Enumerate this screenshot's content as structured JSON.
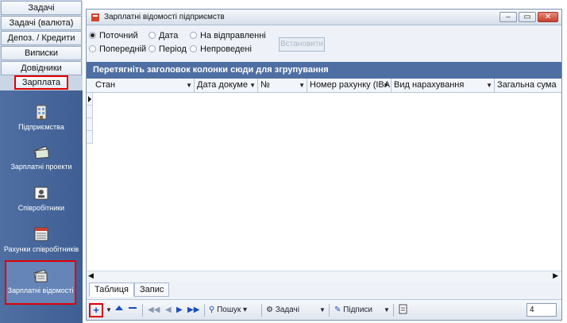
{
  "nav": {
    "top_buttons": [
      "Задачі",
      "Задачі (валюта)",
      "Депоз. / Кредити",
      "Виписки",
      "Довідники",
      "Зарплата"
    ],
    "active_button": "Зарплата",
    "items": [
      "Підприємства",
      "Зарплатні проекти",
      "Співробітники",
      "Рахунки співробітників",
      "Зарплатні відомості"
    ],
    "selected_item": "Зарплатні відомості"
  },
  "window": {
    "title": "Зарплатні відомості підприємств",
    "min": "–",
    "max": "▭",
    "close": "✕"
  },
  "filters": {
    "row1": [
      "Поточний",
      "Дата",
      "На відправленні"
    ],
    "row2": [
      "Попередній",
      "Період",
      "Непроведені"
    ],
    "selected": "Поточний",
    "apply_label": "Встановити"
  },
  "grid": {
    "group_hint": "Перетягніть заголовок колонки сюди для згрупування",
    "columns": [
      "Стан",
      "Дата докуме",
      "№",
      "Номер рахунку (IBA",
      "Вид нарахування",
      "Загальна сума"
    ]
  },
  "tabs": [
    "Таблиця",
    "Запис"
  ],
  "toolbar": {
    "add": "+",
    "search": "Пошук",
    "tasks": "Задачі",
    "signatures": "Підписи",
    "counter": "4"
  },
  "colors": {
    "accent": "#4f6fa3",
    "highlight": "#e00000"
  }
}
